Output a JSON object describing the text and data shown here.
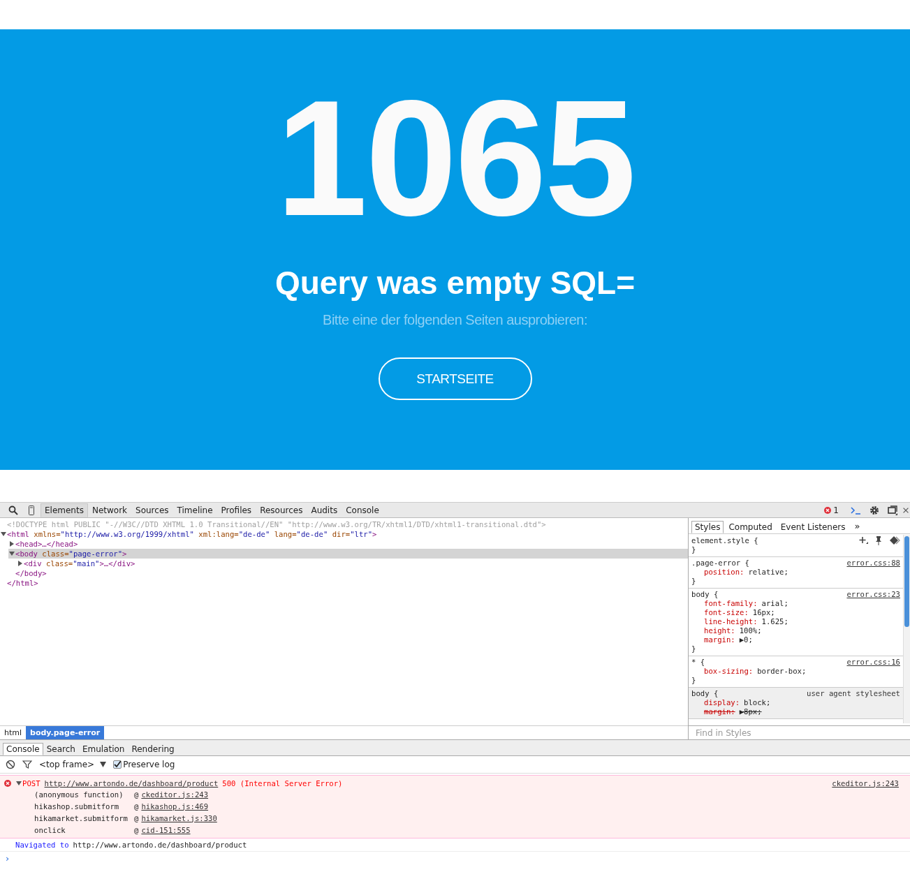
{
  "page": {
    "code": "1065",
    "title": "Query was empty SQL=",
    "subtitle": "Bitte eine der folgenden Seiten ausprobieren:",
    "button": "STARTSEITE"
  },
  "devtools": {
    "tabs": [
      {
        "label": "Elements",
        "selected": true
      },
      {
        "label": "Network",
        "selected": false
      },
      {
        "label": "Sources",
        "selected": false
      },
      {
        "label": "Timeline",
        "selected": false
      },
      {
        "label": "Profiles",
        "selected": false
      },
      {
        "label": "Resources",
        "selected": false
      },
      {
        "label": "Audits",
        "selected": false
      },
      {
        "label": "Console",
        "selected": false
      }
    ],
    "error_count": "1",
    "dom_tree": [
      {
        "kind": "doctype",
        "tokens": [
          {
            "kind": "doctype",
            "text": "<!DOCTYPE html PUBLIC \"-//W3C//DTD XHTML 1.0 Transitional//EN\" \"http://www.w3.org/TR/xhtml1/DTD/xhtml1-transitional.dtd\">"
          }
        ]
      },
      {
        "kind": "element",
        "expanded": true,
        "selected": false,
        "tokens": [
          {
            "kind": "tag",
            "text": "<html"
          },
          {
            "kind": "attr",
            "text": " xmlns="
          },
          {
            "kind": "value",
            "text": "\"http://www.w3.org/1999/xhtml\""
          },
          {
            "kind": "attr",
            "text": " xml:lang="
          },
          {
            "kind": "value",
            "text": "\"de-de\""
          },
          {
            "kind": "attr",
            "text": " lang="
          },
          {
            "kind": "value",
            "text": "\"de-de\""
          },
          {
            "kind": "attr",
            "text": " dir="
          },
          {
            "kind": "value",
            "text": "\"ltr\""
          },
          {
            "kind": "tag",
            "text": ">"
          }
        ],
        "closing": "</html>",
        "children": [
          {
            "kind": "element",
            "expanded": false,
            "selected": false,
            "tokens": [
              {
                "kind": "tag",
                "text": "<head>…</head>"
              }
            ]
          },
          {
            "kind": "element",
            "expanded": true,
            "selected": true,
            "tokens": [
              {
                "kind": "tag",
                "text": "<body"
              },
              {
                "kind": "attr",
                "text": " class="
              },
              {
                "kind": "value",
                "text": "\"page-error\""
              },
              {
                "kind": "tag",
                "text": ">"
              }
            ],
            "closing": "</body>",
            "children": [
              {
                "kind": "element",
                "expanded": false,
                "selected": false,
                "tokens": [
                  {
                    "kind": "tag",
                    "text": "<div"
                  },
                  {
                    "kind": "attr",
                    "text": " class="
                  },
                  {
                    "kind": "value",
                    "text": "\"main\""
                  },
                  {
                    "kind": "tag",
                    "text": ">…</div>"
                  }
                ]
              }
            ]
          }
        ]
      }
    ],
    "breadcrumbs": [
      {
        "label": "html",
        "selected": false
      },
      {
        "label": "body.page-error",
        "selected": true
      }
    ],
    "styles_tabs": [
      {
        "label": "Styles",
        "selected": true
      },
      {
        "label": "Computed",
        "selected": false
      },
      {
        "label": "Event Listeners",
        "selected": false
      }
    ],
    "styles_more": "»",
    "rules": [
      {
        "kind": "inline",
        "selector": "element.style {",
        "close": "}"
      },
      {
        "kind": "author",
        "selector": ".page-error {",
        "source": "error.css:88",
        "props": [
          {
            "name": "position:",
            "value": "relative;",
            "struck": false
          }
        ],
        "close": "}"
      },
      {
        "kind": "author",
        "selector": "body {",
        "source": "error.css:23",
        "props": [
          {
            "name": "font-family:",
            "value": "arial;",
            "struck": false
          },
          {
            "name": "font-size:",
            "value": "16px;",
            "struck": false
          },
          {
            "name": "line-height:",
            "value": "1.625;",
            "struck": false
          },
          {
            "name": "height:",
            "value": "100%;",
            "struck": false
          },
          {
            "name": "margin:",
            "value": "▶0;",
            "struck": false
          }
        ],
        "close": "}"
      },
      {
        "kind": "author",
        "selector": "* {",
        "source": "error.css:16",
        "props": [
          {
            "name": "box-sizing:",
            "value": "border-box;",
            "struck": false
          }
        ],
        "close": "}"
      },
      {
        "kind": "user_agent",
        "selector": "body {",
        "source": "user agent stylesheet",
        "props": [
          {
            "name": "display:",
            "value": "block;",
            "struck": false
          },
          {
            "name": "margin:",
            "value": "▶8px;",
            "struck": true
          }
        ]
      }
    ],
    "styles_filter": {
      "placeholder": "Find in Styles"
    },
    "drawer_tabs": [
      {
        "label": "Console",
        "selected": true
      },
      {
        "label": "Search",
        "selected": false
      },
      {
        "label": "Emulation",
        "selected": false
      },
      {
        "label": "Rendering",
        "selected": false
      }
    ],
    "console_toolbar": {
      "frame": "<top frame>",
      "preserve_log": {
        "label": "Preserve log",
        "checked": true
      }
    },
    "messages": [
      {
        "kind": "error",
        "expanded": true,
        "method": "POST",
        "url": "http://www.artondo.de/dashboard/product",
        "status": "500 (Internal Server Error)",
        "source": "ckeditor.js:243",
        "stack": [
          {
            "function": "(anonymous function)",
            "at": "@",
            "location": "ckeditor.js:243"
          },
          {
            "function": "hikashop.submitform",
            "at": "@",
            "location": "hikashop.js:469"
          },
          {
            "function": "hikamarket.submitform",
            "at": "@",
            "location": "hikamarket.js:330"
          },
          {
            "function": "onclick",
            "at": "@",
            "location": "cid-151:555"
          }
        ]
      },
      {
        "kind": "info",
        "label": "Navigated to",
        "url": "http://www.artondo.de/dashboard/product"
      }
    ],
    "prompt": "›"
  }
}
